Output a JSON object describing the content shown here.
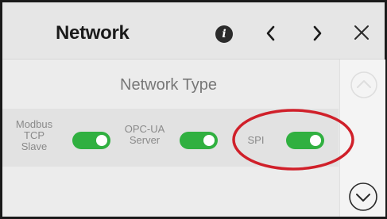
{
  "header": {
    "title": "Network",
    "info_icon": "info-icon",
    "prev_icon": "chevron-left-icon",
    "next_icon": "chevron-right-icon",
    "close_icon": "close-icon"
  },
  "network_type": {
    "heading": "Network Type",
    "options": [
      {
        "label_lines": [
          "Modbus",
          "TCP",
          "Slave"
        ],
        "enabled": true
      },
      {
        "label_lines": [
          "OPC-UA",
          "Server"
        ],
        "enabled": true
      },
      {
        "label_lines": [
          "SPI"
        ],
        "enabled": true
      }
    ]
  },
  "scroll": {
    "up_icon": "chevron-up-circle-icon",
    "down_icon": "chevron-down-circle-icon"
  },
  "colors": {
    "toggle_on": "#30b040",
    "highlight": "#d0202a",
    "disabled_grey": "#8a8a8a"
  }
}
